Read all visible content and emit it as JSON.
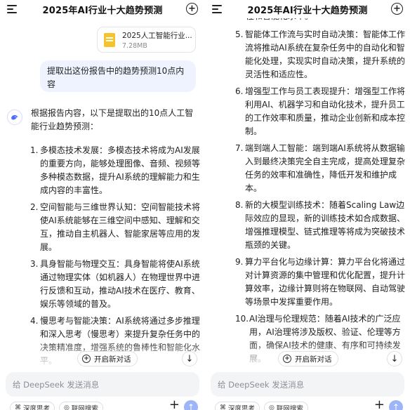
{
  "header": {
    "title": "2025年AI行业十大趋势预测"
  },
  "file": {
    "name": "2025人工智能行业...",
    "size": "7.28MB"
  },
  "user_message": "提取出这份报告中的趋势预测10点内容",
  "assistant": {
    "intro": "根据报告内容，以下是提取出的10点人工智能行业趋势预测：",
    "points": [
      {
        "num": "1.",
        "text": "多模态技术发展：多模态技术将成为AI发展的重要方向，能够处理图像、音频、视频等多种模态数据，提升AI系统的理解能力和生成内容的丰富性。"
      },
      {
        "num": "2.",
        "text": "空间智能与三维世界认知：空间智能技术将使AI系统能够在三维空间中感知、理解和交互，推动自主机器人、智能家居等应用的发展。"
      },
      {
        "num": "3.",
        "text": "具身智能与物理交互：具身智能将使AI系统通过物理实体（如机器人）在物理世界中进行反馈和互动，推动AI技术在医疗、教育、娱乐等领域的普及。"
      },
      {
        "num": "4.",
        "text": "慢思考与智能决策：AI系统将通过多步推理和深入思考（慢思考）来提升复杂任务中的决策精准度，增强系统的鲁棒性和智能化水平。"
      },
      {
        "num": "5.",
        "text": "智能体工作流与实时自动决策：智能体工作流将推动AI系统在复杂任务中的自动化和智能化处理，实现实时自动决策，提升系统的灵活性和适应性。"
      },
      {
        "num": "6.",
        "text": "增强型工作与员工表现提升：增强型工作将利用AI、机器学习和自动化技术，提升员工的工作效率和质量，推动企业创新和成本控制。"
      },
      {
        "num": "7.",
        "text": "端到端人工智能：端到端AI系统将从数据输入到最终决策完全自主完成，提高处理复杂任务的效率和准确性，降低开发和维护成本。"
      },
      {
        "num": "8.",
        "text": "新的大模型训练技术：随着Scaling Law边际效应的显现，新的训练技术如合成数据、增强推理模型、链式推理等将成为突破技术瓶颈的关键。"
      },
      {
        "num": "9.",
        "text": "算力平台化与边缘计算：算力平台化将通过对计算资源的集中管理和优化配置，提升计算效率，边缘计算则将在物联网、自动驾驶等场景中发挥重要作用。"
      },
      {
        "num": "10.",
        "text": "AI治理与伦理规范：随着AI技术的广泛应用，AI治理将涉及版权、验证、伦理等方面，确保AI技术的健康、有序和可持续发展。"
      }
    ],
    "right_top_fragment": "性和智能化水平。",
    "left_bottom_fragment": "5. 智能体工作流与实时自动决策：智能体"
  },
  "controls": {
    "new_chat_label": "开启新对话",
    "input_placeholder": "给 DeepSeek 发送消息",
    "deep_think_label": "深度思考",
    "web_search_label": "联网搜索"
  },
  "colors": {
    "user_bubble": "#eef3ff",
    "send_button": "#9db5f7",
    "file_icon": "#f6c22d",
    "brand": "#4d6bfe"
  },
  "icons": {
    "menu": "menu-icon",
    "new_chat": "plus-circle-icon",
    "assistant": "deepseek-whale-icon",
    "scroll_down": "arrow-down-icon",
    "send": "arrow-up-icon"
  }
}
